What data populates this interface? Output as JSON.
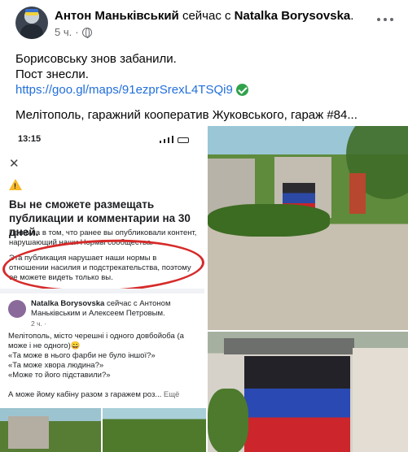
{
  "post": {
    "author": "Антон Маньківський",
    "verb": "сейчас с",
    "tagged": "Natalka Borysovska",
    "tagged_suffix": ".",
    "time": "5 ч.",
    "separator": "·",
    "lines": [
      "Борисовську знов забанили.",
      "Пост знесли."
    ],
    "link": "https://goo.gl/maps/91ezprSrexL4TSQi9",
    "location": "Мелітополь, гаражний кооператив Жуковського, гараж #84..."
  },
  "screenshot": {
    "status_time": "13:15",
    "close_glyph": "✕",
    "warn_glyph": "!",
    "ban_title": "Вы не сможете размещать публикации и комментарии на 30 дней.",
    "ban_reason": "Причина в том, что ранее вы опубликовали контент, нарушающий наши Нормы сообщества.",
    "ban_detail": "Эта публикация нарушает наши нормы в отношении насилия и подстрекательства, поэтому ее можете видеть только вы.",
    "mini_author_name": "Natalka Borysovska",
    "mini_author_rest": "сейчас с Антоном Маньківським и Алексеем Петровым.",
    "mini_time": "2 ч. ·",
    "mini_lines": [
      "Мелітополь, місто черешні і одного довбойоба (а",
      "може і не одного)😄",
      "«Та може в нього фарби не було іншої?»",
      "«Та може хвора людина?»",
      "«Може то його підставили?»",
      "",
      "А може йому кабіну разом з гаражем роз..."
    ],
    "mini_more": "Ещё"
  },
  "colors": {
    "link": "#216fdb",
    "verified": "#31a24c",
    "ban_circle": "#d62a2a",
    "warning": "#f7b928"
  },
  "icons": [
    "globe-icon",
    "verified-check-icon",
    "more-options-icon",
    "close-icon",
    "warning-icon"
  ]
}
